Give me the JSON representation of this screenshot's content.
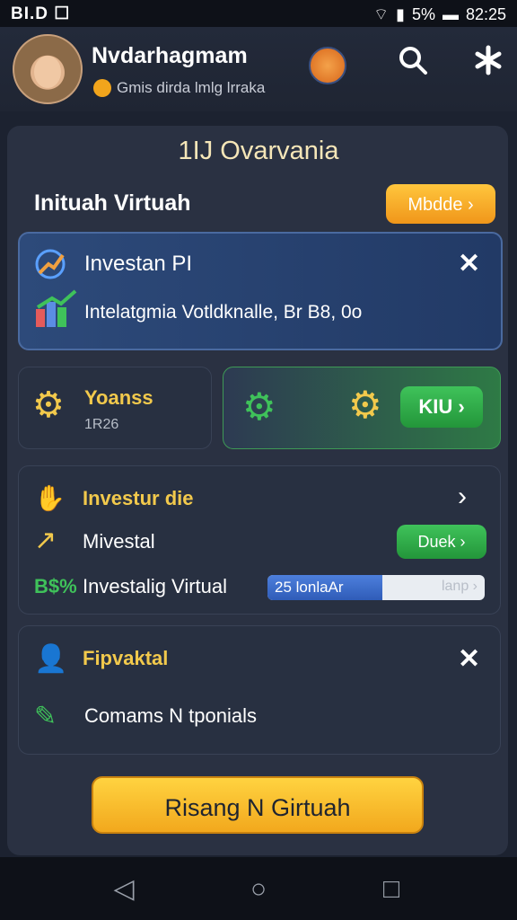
{
  "status_bar": {
    "left": "BI.D ☐",
    "time": "82:25",
    "signal_text": "5%"
  },
  "header": {
    "username": "Nvdarhagmam",
    "subline": "Gmis  dirda lmlg lrraka",
    "icons": [
      "avatar",
      "badge-icon",
      "search-icon",
      "settings-icon"
    ]
  },
  "panel": {
    "title": "1IJ Ovarvania",
    "section_label": "Inituah Virtuah",
    "section_button": "Mbdde ›"
  },
  "invest_card": {
    "title": "Investan PI",
    "subtitle": "Intelatgmia Votldknalle, Br B8, 0o"
  },
  "yoanss_card": {
    "title": "Yoanss",
    "subtitle": "1R26"
  },
  "kiu_card": {
    "button": "KIU ›"
  },
  "list_card": {
    "header": "Investur die",
    "row1_label": "Mivestal",
    "row1_button": "Duek ›",
    "row2_prefix": "B$%",
    "row2_label": "Investalig Virtual",
    "progress_text": "25 lonlaAr",
    "progress_right": "lanp ›",
    "progress_fraction": 0.53
  },
  "fip_card": {
    "header": "Fipvaktal",
    "row_label": "Comams N tponials"
  },
  "main_button": "Risang N Girtuah",
  "colors": {
    "accent_orange": "#f0961a",
    "accent_green": "#23963a",
    "accent_blue": "#2f5cb8"
  }
}
